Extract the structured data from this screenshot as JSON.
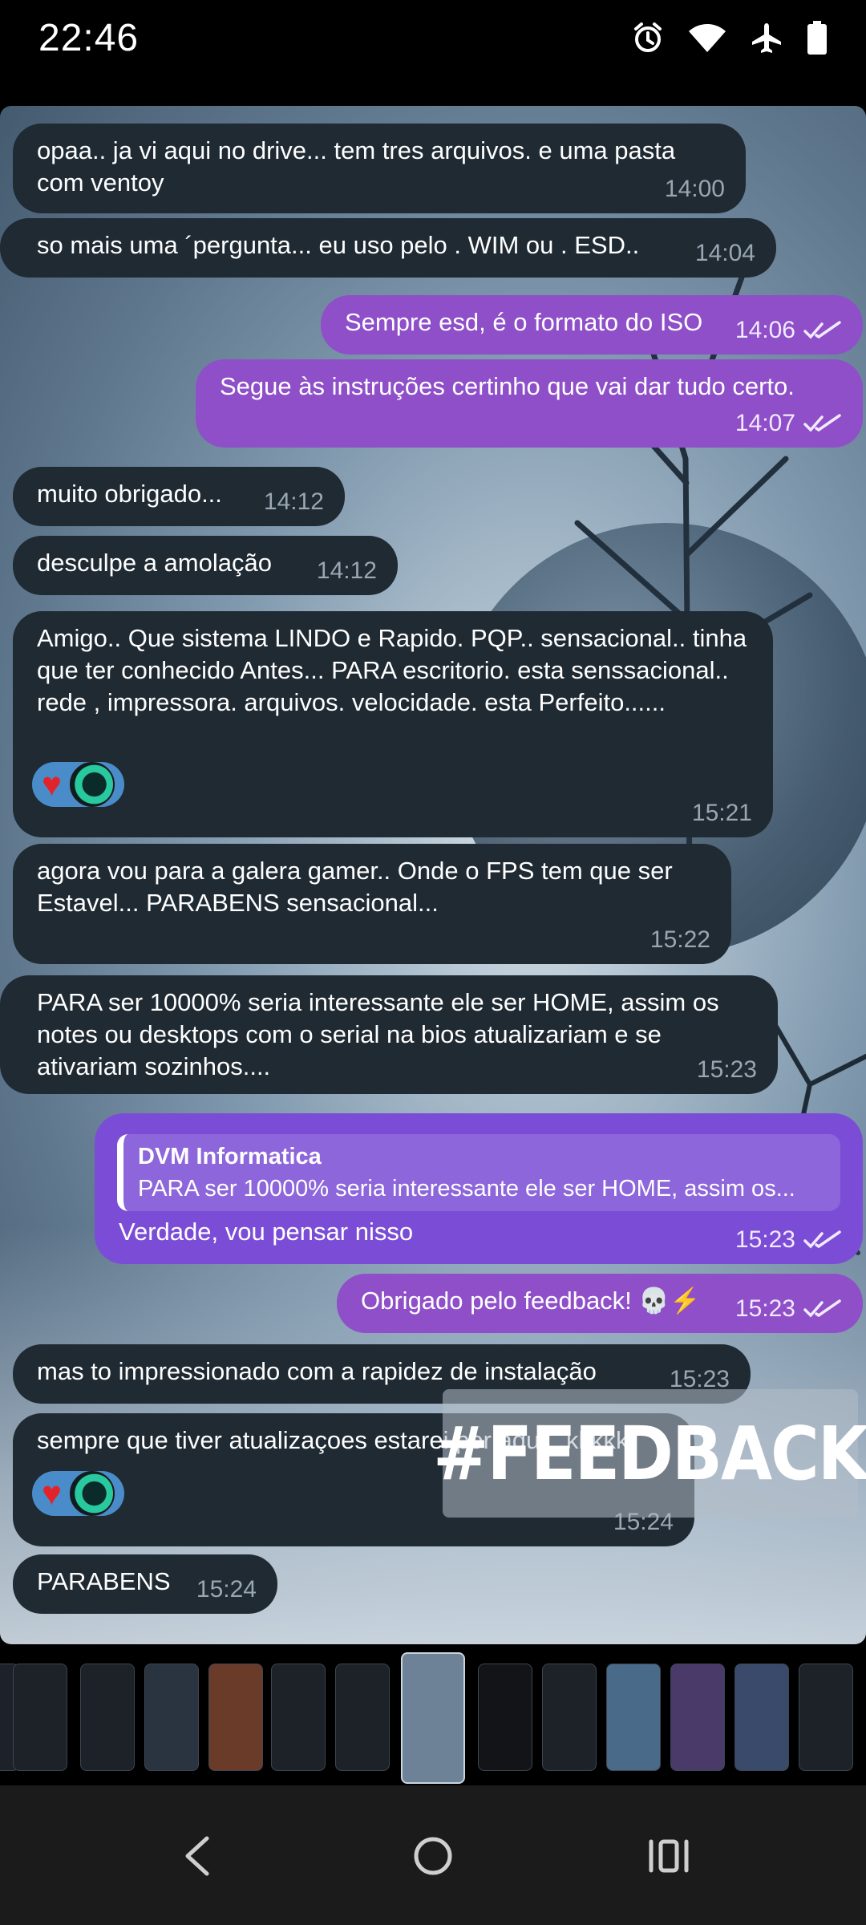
{
  "status_bar": {
    "time": "22:46",
    "icons": [
      "alarm-icon",
      "wifi-icon",
      "airplane-mode-icon",
      "battery-icon"
    ]
  },
  "messages": [
    {
      "dir": "in",
      "text": "opaa.. ja vi aqui no drive... tem tres arquivos. e uma pasta com ventoy",
      "time": "14:00"
    },
    {
      "dir": "in",
      "text": "so mais uma ´pergunta... eu uso pelo . WIM ou . ESD..",
      "time": "14:04"
    },
    {
      "dir": "out",
      "text": "Sempre esd, é o formato do ISO",
      "time": "14:06"
    },
    {
      "dir": "out",
      "text": "Segue às instruções certinho que vai dar tudo certo.",
      "time": "14:07"
    },
    {
      "dir": "in",
      "text": "muito obrigado...",
      "time": "14:12"
    },
    {
      "dir": "in",
      "text": "desculpe a amolação",
      "time": "14:12"
    },
    {
      "dir": "in",
      "text": "Amigo..  Que sistema LINDO e Rapido. PQP.. sensacional.. tinha que ter conhecido Antes... PARA escritorio. esta senssacional.. rede , impressora. arquivos. velocidade. esta Perfeito......",
      "time": "15:21",
      "reactions": [
        "heart",
        "avatar"
      ]
    },
    {
      "dir": "in",
      "text": "agora vou para a galera gamer.. Onde o FPS tem que ser Estavel... PARABENS sensacional...",
      "time": "15:22"
    },
    {
      "dir": "in",
      "text": "PARA ser 10000% seria interessante ele ser HOME, assim os notes ou desktops com o serial na bios atualizariam e se ativariam sozinhos....",
      "time": "15:23"
    },
    {
      "dir": "out",
      "reply_name": "DVM Informatica",
      "reply_text": "PARA ser 10000% seria interessante ele ser HOME, assim os...",
      "text": "Verdade, vou pensar nisso",
      "time": "15:23"
    },
    {
      "dir": "out",
      "text": "Obrigado pelo feedback! 💀⚡",
      "time": "15:23"
    },
    {
      "dir": "in",
      "text": "mas to impressionado com a rapidez de instalação",
      "time": "15:23"
    },
    {
      "dir": "in",
      "text": "sempre que tiver atualizaçoes estarei por aqui.. kkkkk",
      "time": "15:24",
      "reactions": [
        "heart",
        "avatar"
      ]
    },
    {
      "dir": "in",
      "text": "PARABENS",
      "time": "15:24"
    }
  ],
  "overlay_tag": "#FEEDBACK",
  "gallery": {
    "thumbnail_count": 14,
    "active_index": 6
  },
  "nav_bar": {
    "buttons": [
      "back-icon",
      "home-icon",
      "recents-icon"
    ]
  },
  "colors": {
    "incoming_bubble": "#1f2a33",
    "outgoing_bubble": "#8e4fc9",
    "reply_bubble": "#7b4dd6",
    "reaction_pill": "#4a8cc9"
  }
}
